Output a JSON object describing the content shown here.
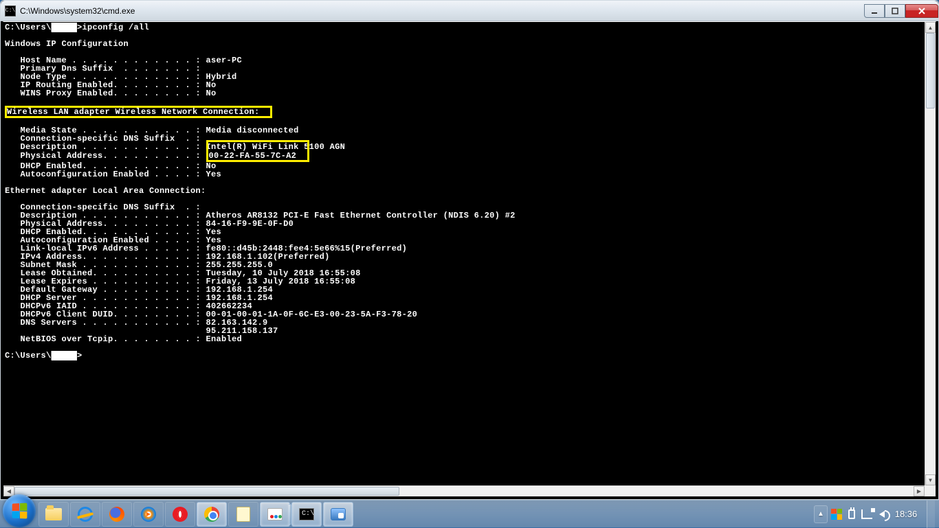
{
  "title": "C:\\Windows\\system32\\cmd.exe",
  "prompt1": "C:\\Users\\",
  "cmd": "ipconfig /all",
  "win_heading": "Windows IP Configuration",
  "win": {
    "host": "   Host Name . . . . . . . . . . . . : aser-PC",
    "dns": "   Primary Dns Suffix  . . . . . . . :",
    "node": "   Node Type . . . . . . . . . . . . : Hybrid",
    "iprt": "   IP Routing Enabled. . . . . . . . : No",
    "wins": "   WINS Proxy Enabled. . . . . . . . : No"
  },
  "wlan_heading": "Wireless LAN adapter Wireless Network Connection:",
  "wlan": {
    "media": "   Media State . . . . . . . . . . . : Media disconnected",
    "dns": "   Connection-specific DNS Suffix  . :",
    "desc_lbl": "   Description . . . . . . . . . . . : ",
    "desc_pre": "Intel(R) WiFi Link 5",
    "desc_post": "100 AGN",
    "phys_lbl": "   Physical Address. . . . . . . . . : ",
    "phys_val": "00-22-FA-55-7C-A2",
    "dhcp_lbl": "   DHCP Enabled. . . . . . . . . . . : ",
    "dhcp_val": "No",
    "auto": "   Autoconfiguration Enabled . . . . : Yes"
  },
  "eth_heading": "Ethernet adapter Local Area Connection:",
  "eth": {
    "dns": "   Connection-specific DNS Suffix  . :",
    "desc": "   Description . . . . . . . . . . . : Atheros AR8132 PCI-E Fast Ethernet Controller (NDIS 6.20) #2",
    "phys": "   Physical Address. . . . . . . . . : 84-16-F9-9E-0F-D0",
    "dhcp": "   DHCP Enabled. . . . . . . . . . . : Yes",
    "auto": "   Autoconfiguration Enabled . . . . : Yes",
    "ll6": "   Link-local IPv6 Address . . . . . : fe80::d45b:2448:fee4:5e66%15(Preferred)",
    "ip4": "   IPv4 Address. . . . . . . . . . . : 192.168.1.102(Preferred)",
    "mask": "   Subnet Mask . . . . . . . . . . . : 255.255.255.0",
    "lob": "   Lease Obtained. . . . . . . . . . : Tuesday, 10 July 2018 16:55:08",
    "lex": "   Lease Expires . . . . . . . . . . : Friday, 13 July 2018 16:55:08",
    "gw": "   Default Gateway . . . . . . . . . : 192.168.1.254",
    "dsrv": "   DHCP Server . . . . . . . . . . . : 192.168.1.254",
    "iaid": "   DHCPv6 IAID . . . . . . . . . . . : 402662234",
    "duid": "   DHCPv6 Client DUID. . . . . . . . : 00-01-00-01-1A-0F-6C-E3-00-23-5A-F3-78-20",
    "dns1": "   DNS Servers . . . . . . . . . . . : 82.163.142.9",
    "dns2": "                                       95.211.158.137",
    "nbt": "   NetBIOS over Tcpip. . . . . . . . : Enabled"
  },
  "prompt2": "C:\\Users\\",
  "prompt2_tail": ">",
  "mask_text": "█████",
  "tray": {
    "time": "18:36"
  }
}
